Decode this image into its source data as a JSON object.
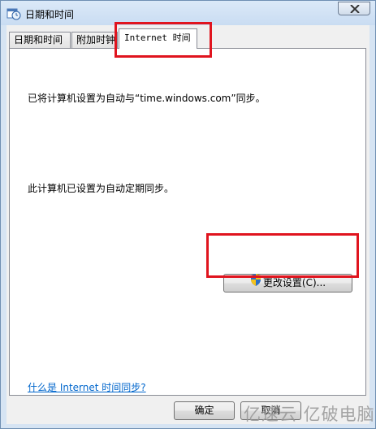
{
  "window": {
    "title": "日期和时间"
  },
  "tabs": [
    {
      "label": "日期和时间",
      "selected": false
    },
    {
      "label": "附加时钟",
      "selected": false
    },
    {
      "label": "Internet 时间",
      "selected": true
    }
  ],
  "panel": {
    "sync_text": "已将计算机设置为自动与“time.windows.com”同步。",
    "auto_text": "此计算机已设置为自动定期同步。",
    "change_button": "更改设置(C)...",
    "help_link": "什么是 Internet 时间同步?"
  },
  "footer": {
    "ok_label": "确定",
    "cancel_label": "取消"
  },
  "watermark": "亿速云 亿破电脑",
  "colors": {
    "highlight": "#e0141e",
    "link": "#0066cc",
    "titlebar": "#c9dcf2"
  },
  "icons": {
    "title": "clock-calendar-icon",
    "close": "close-icon",
    "button": "uac-shield-icon"
  }
}
